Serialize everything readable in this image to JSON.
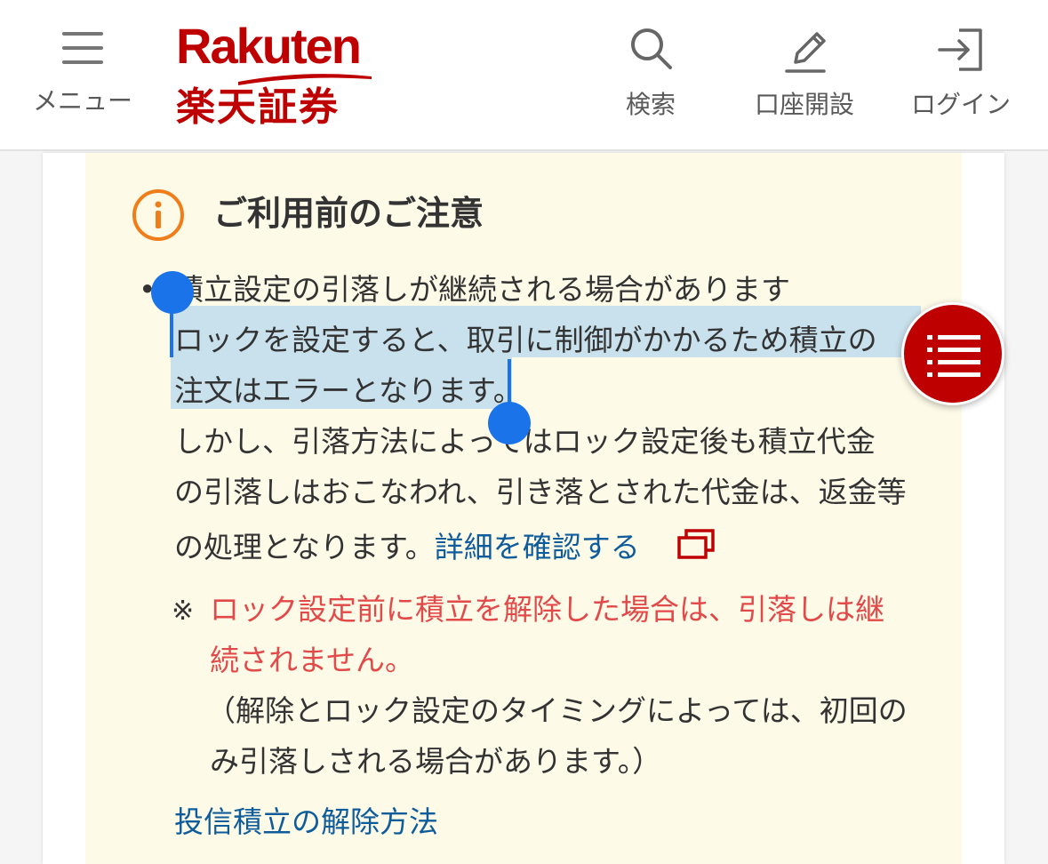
{
  "header": {
    "menu_label": "メニュー",
    "search_label": "検索",
    "account_label": "口座開設",
    "login_label": "ログイン",
    "logo_en": "Rakuten",
    "logo_jp": "楽天証券",
    "brand_color": "#bf0000"
  },
  "notice": {
    "title": "ご利用前のご注意",
    "lines": [
      "積立設定の引落しが継続される場合があります",
      "ロックを設定すると、取引に制御がかかるため積立の",
      "注文はエラーとなります。",
      "しかし、引落方法によってはロック設定後も積立代金",
      "の引落しはおこなわれ、引き落とされた代金は、返金等",
      "の処理となります。"
    ],
    "detail_link": "詳細を確認する",
    "note_mark": "※",
    "red_lines": [
      "ロック設定前に積立を解除した場合は、引落しは継",
      "続されません。"
    ],
    "paren_lines": [
      "（解除とロック設定のタイミングによっては、初回の",
      "み引落しされる場合があります。）"
    ],
    "bottom_link": "投信積立の解除方法"
  },
  "colors": {
    "notice_bg": "#fdfae8",
    "link": "#0f5c9b",
    "warning": "#e24a4a",
    "info_icon": "#ef7d1a",
    "selection": "#c9e1ec",
    "handle": "#1a73e8"
  },
  "icons": [
    "hamburger-icon",
    "search-icon",
    "pencil-icon",
    "login-icon",
    "info-icon",
    "external-window-icon",
    "toc-list-icon"
  ]
}
